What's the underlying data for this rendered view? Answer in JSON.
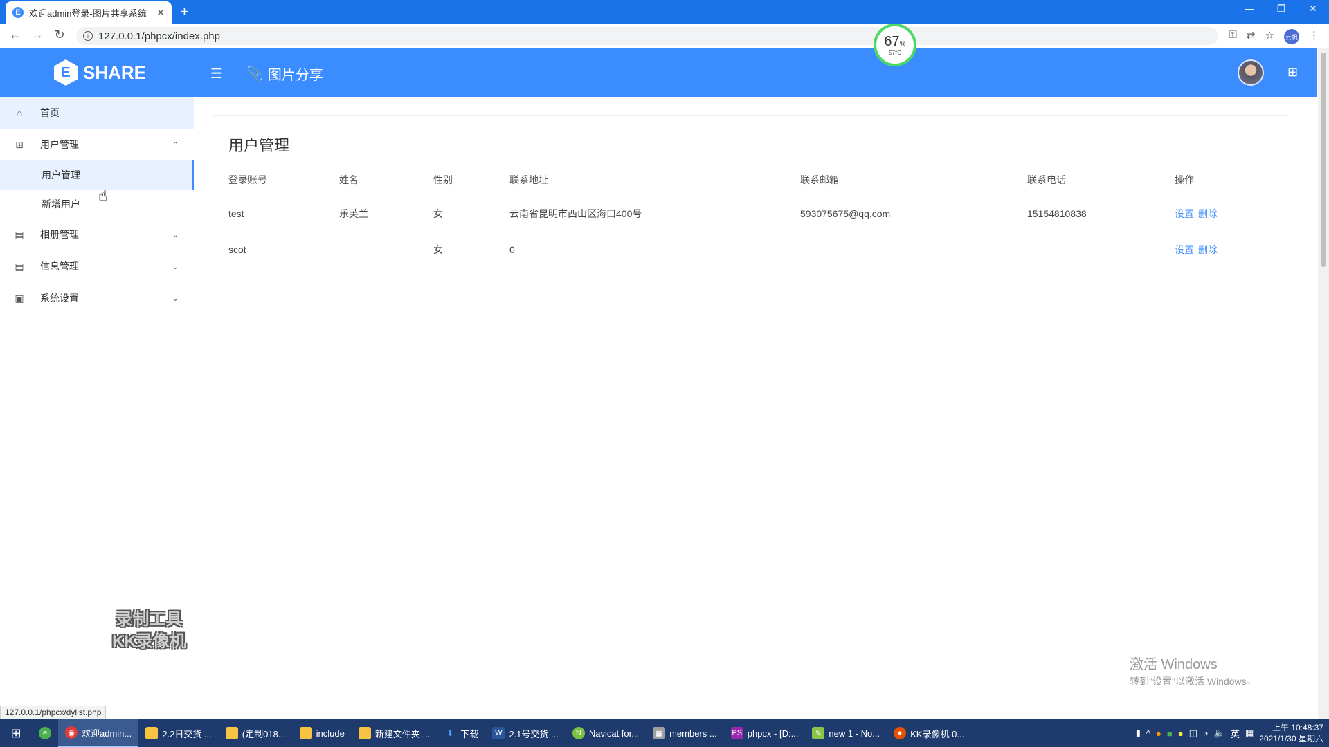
{
  "browser": {
    "tab_title": "欢迎admin登录-图片共享系统",
    "tab_favicon": "E",
    "url": "127.0.0.1/phpcx/index.php",
    "profile_label": "云帆",
    "status_url": "127.0.0.1/phpcx/dylist.php"
  },
  "cpu_badge": {
    "percent": "67",
    "percent_unit": "%",
    "temp": "57°C"
  },
  "header": {
    "logo_mark": "E",
    "logo_text": "SHARE",
    "title": "图片分享"
  },
  "sidebar": {
    "home": "首页",
    "user_mgmt": "用户管理",
    "user_mgmt_sub": [
      "用户管理",
      "新增用户"
    ],
    "album_mgmt": "相册管理",
    "info_mgmt": "信息管理",
    "system_settings": "系统设置"
  },
  "main": {
    "title": "用户管理",
    "columns": [
      "登录账号",
      "姓名",
      "性别",
      "联系地址",
      "联系邮箱",
      "联系电话",
      "操作"
    ],
    "rows": [
      {
        "account": "test",
        "name": "乐芙兰",
        "gender": "女",
        "address": "云南省昆明市西山区海口400号",
        "email": "593075675@qq.com",
        "phone": "15154810838",
        "op_set": "设置",
        "op_delete": "删除"
      },
      {
        "account": "scot",
        "name": "",
        "gender": "女",
        "address": "0",
        "email": "",
        "phone": "",
        "op_set": "设置",
        "op_delete": "删除"
      }
    ]
  },
  "watermark": {
    "line1": "录制工具",
    "line2": "KK录像机"
  },
  "activate": {
    "line1": "激活 Windows",
    "line2": "转到\"设置\"以激活 Windows。"
  },
  "taskbar": {
    "items": [
      "欢迎admin...",
      "2.2日交货 ...",
      "(定制018...",
      "include",
      "新建文件夹 ...",
      "下载",
      "2.1号交货 ...",
      "Navicat for...",
      "members ...",
      "phpcx - [D:...",
      "new 1 - No...",
      "KK录像机 0..."
    ],
    "ime": "英",
    "time": "上午 10:48:37",
    "date": "2021/1/30 星期六"
  },
  "colors": {
    "primary": "#3b8cff",
    "taskbar": "#1f3b6e",
    "tabstrip": "#1a73e8"
  }
}
